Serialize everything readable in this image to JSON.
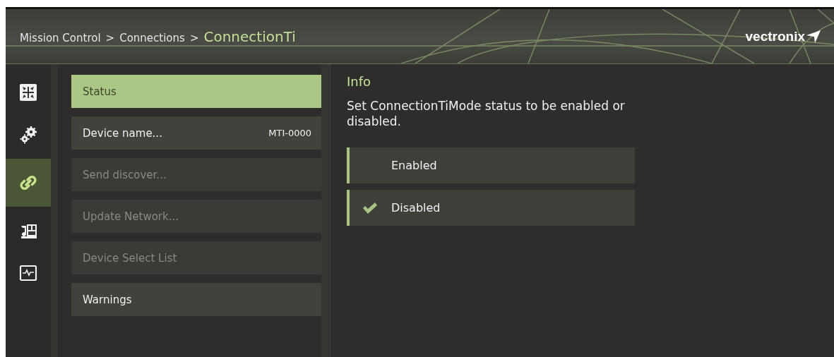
{
  "header": {
    "breadcrumb": [
      {
        "kind": "link",
        "text": "Mission Control"
      },
      {
        "kind": "sep",
        "text": ">"
      },
      {
        "kind": "link",
        "text": "Connections"
      },
      {
        "kind": "sep",
        "text": ">"
      },
      {
        "kind": "current",
        "text": "ConnectionTi"
      }
    ],
    "logo": "vectronix"
  },
  "rail": [
    {
      "kind": "grid",
      "selected": false
    },
    {
      "kind": "gears",
      "selected": false
    },
    {
      "kind": "link",
      "selected": true
    },
    {
      "kind": "media",
      "selected": false
    },
    {
      "kind": "monitor",
      "selected": false
    }
  ],
  "menu": [
    {
      "label": "Status",
      "selected": true,
      "disabled": false
    },
    {
      "label": "Device name...",
      "value": "MTI-0000",
      "selected": false,
      "disabled": false
    },
    {
      "label": "Send discover...",
      "selected": false,
      "disabled": true
    },
    {
      "label": "Update Network...",
      "selected": false,
      "disabled": true
    },
    {
      "label": "Device Select List",
      "selected": false,
      "disabled": true
    },
    {
      "label": "Warnings",
      "selected": false,
      "disabled": false
    }
  ],
  "info": {
    "title": "Info",
    "description": "Set ConnectionTiMode status to be enabled or disabled.",
    "options": [
      {
        "label": "Enabled",
        "checked": false
      },
      {
        "label": "Disabled",
        "checked": true
      }
    ]
  }
}
